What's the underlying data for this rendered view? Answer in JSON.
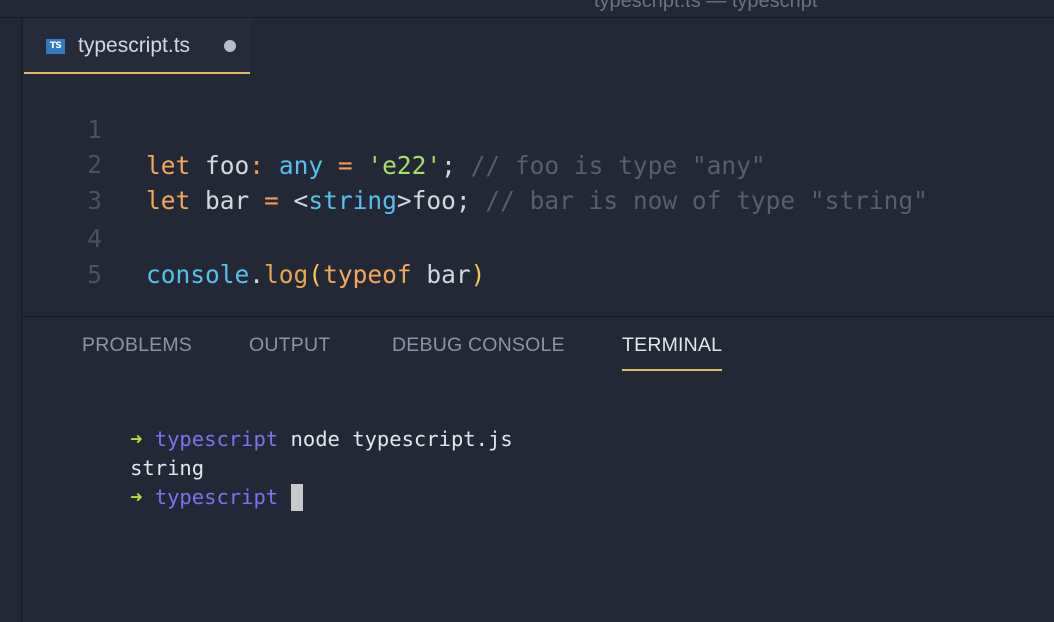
{
  "titlebar": {
    "text": "typescript.ts — typescript"
  },
  "tab": {
    "icon_label": "TS",
    "label": "typescript.ts"
  },
  "editor": {
    "line_numbers": [
      "1",
      "2",
      "3",
      "4",
      "5"
    ],
    "lines": [
      [
        {
          "t": "let",
          "c": "kw"
        },
        {
          "t": " ",
          "c": "id"
        },
        {
          "t": "foo",
          "c": "id"
        },
        {
          "t": ":",
          "c": "op"
        },
        {
          "t": " ",
          "c": "id"
        },
        {
          "t": "any",
          "c": "type"
        },
        {
          "t": " ",
          "c": "id"
        },
        {
          "t": "=",
          "c": "op"
        },
        {
          "t": " ",
          "c": "id"
        },
        {
          "t": "'e22'",
          "c": "str"
        },
        {
          "t": ";",
          "c": "id"
        },
        {
          "t": " // foo is type \"any\"",
          "c": "cmt"
        }
      ],
      [
        {
          "t": "let",
          "c": "kw"
        },
        {
          "t": " bar ",
          "c": "id"
        },
        {
          "t": "=",
          "c": "op"
        },
        {
          "t": " <",
          "c": "id"
        },
        {
          "t": "string",
          "c": "type"
        },
        {
          "t": ">foo;",
          "c": "id"
        },
        {
          "t": " // bar is now of type \"string\"",
          "c": "cmt"
        }
      ],
      [],
      [
        {
          "t": "console",
          "c": "obj"
        },
        {
          "t": ".",
          "c": "id"
        },
        {
          "t": "log",
          "c": "fn"
        },
        {
          "t": "(",
          "c": "paren"
        },
        {
          "t": "typeof",
          "c": "kw"
        },
        {
          "t": " bar",
          "c": "id"
        },
        {
          "t": ")",
          "c": "paren"
        }
      ],
      []
    ]
  },
  "panel": {
    "tabs": [
      "PROBLEMS",
      "OUTPUT",
      "DEBUG CONSOLE",
      "TERMINAL"
    ],
    "active_tab": "TERMINAL"
  },
  "terminal": {
    "prompt_arrow": "➜",
    "cwd": "typescript",
    "command": "node typescript.js",
    "output": "string"
  },
  "colors": {
    "background": "#232836",
    "accent": "#e2b864",
    "keyword": "#f4a75a",
    "type": "#56c1e8",
    "string": "#a6de6a",
    "comment": "#575e70",
    "prompt_arrow": "#b5e233",
    "prompt_cwd": "#7b73ee"
  }
}
